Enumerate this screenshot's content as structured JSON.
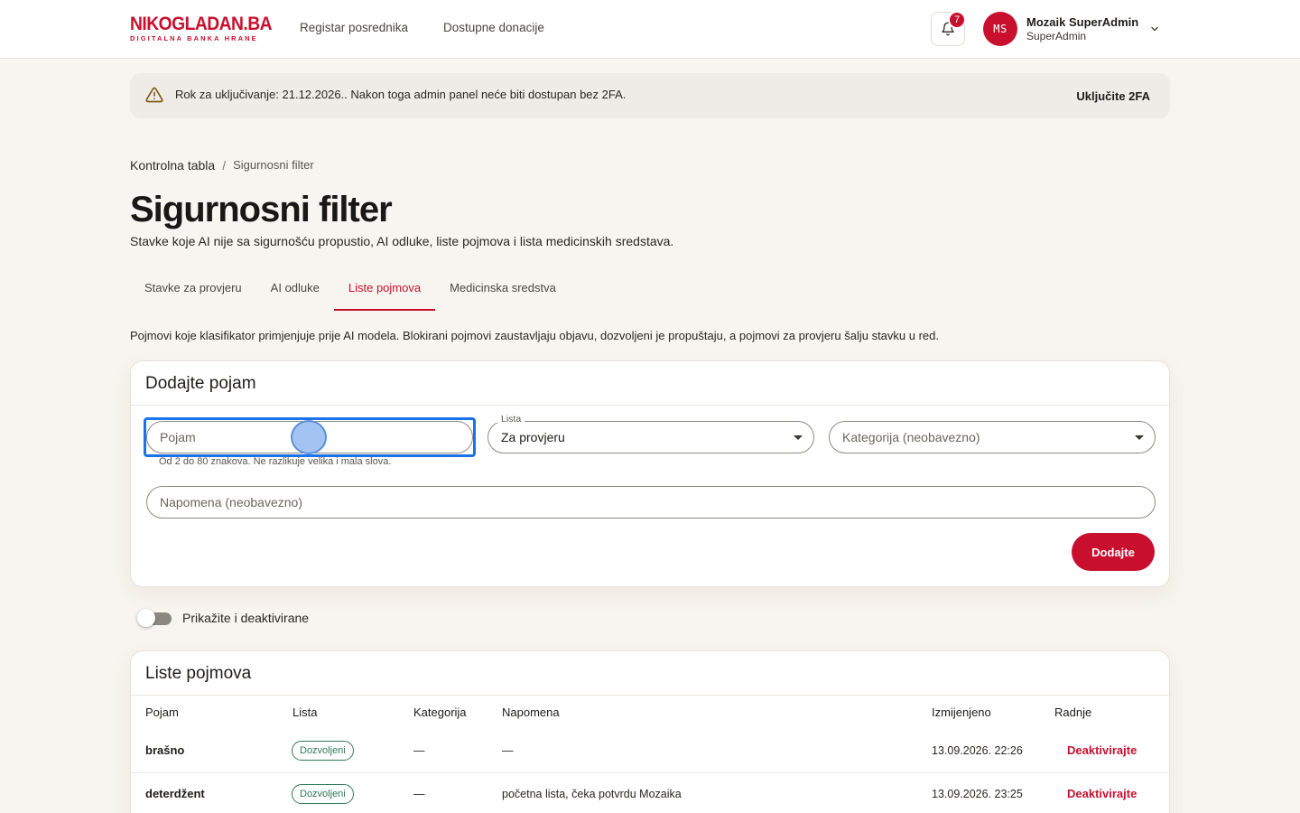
{
  "header": {
    "logo_main": "NIKOGLADAN.BA",
    "logo_sub": "DIGITALNA BANKA HRANE",
    "nav": [
      {
        "label": "Registar posrednika"
      },
      {
        "label": "Dostupne donacije"
      }
    ],
    "notifications_count": "7",
    "user": {
      "initials": "MS",
      "name": "Mozaik SuperAdmin",
      "role": "SuperAdmin"
    }
  },
  "banner": {
    "text": "Rok za uključivanje: 21.12.2026.. Nakon toga admin panel neće biti dostupan bez 2FA.",
    "action": "Uključite 2FA"
  },
  "breadcrumb": {
    "parent": "Kontrolna tabla",
    "separator": "/",
    "current": "Sigurnosni filter"
  },
  "page": {
    "title": "Sigurnosni filter",
    "subtitle": "Stavke koje AI nije sa sigurnošću propustio, AI odluke, liste pojmova i lista medicinskih sredstava.",
    "intro": "Pojmovi koje klasifikator primjenjuje prije AI modela. Blokirani pojmovi zaustavljaju objavu, dozvoljeni je propuštaju, a pojmovi za provjeru šalju stavku u red."
  },
  "tabs": [
    {
      "label": "Stavke za provjeru",
      "active": false
    },
    {
      "label": "AI odluke",
      "active": false
    },
    {
      "label": "Liste pojmova",
      "active": true
    },
    {
      "label": "Medicinska sredstva",
      "active": false
    }
  ],
  "add_form": {
    "title": "Dodajte pojam",
    "term_placeholder": "Pojam",
    "term_helper": "Od 2 do 80 znakova. Ne razlikuje velika i mala slova.",
    "list_label": "Lista",
    "list_value": "Za provjeru",
    "category_placeholder": "Kategorija (neobavezno)",
    "note_placeholder": "Napomena (neobavezno)",
    "submit_label": "Dodajte"
  },
  "toggle": {
    "label": "Prikažite i deaktivirane",
    "checked": false
  },
  "list": {
    "title": "Liste pojmova",
    "columns": [
      "Pojam",
      "Lista",
      "Kategorija",
      "Napomena",
      "Izmijenjeno",
      "Radnje"
    ],
    "rows": [
      {
        "term": "brašno",
        "list": "Dozvoljeni",
        "category": "—",
        "note": "—",
        "modified": "13.09.2026. 22:26",
        "action": "Deaktivirajte"
      },
      {
        "term": "deterdžent",
        "list": "Dozvoljeni",
        "category": "—",
        "note": "početna lista, čeka potvrdu Mozaika",
        "modified": "13.09.2026. 23:25",
        "action": "Deaktivirajte"
      }
    ]
  },
  "colors": {
    "brand": "#c8102e",
    "background": "#f8f4ef",
    "chip_green": "#2f7a55",
    "focus_blue": "#1a73e8"
  },
  "icons": {
    "banner": "warning-triangle-icon",
    "bell": "bell-icon",
    "user_menu": "chevron-down-icon",
    "select": "caret-down-icon"
  }
}
